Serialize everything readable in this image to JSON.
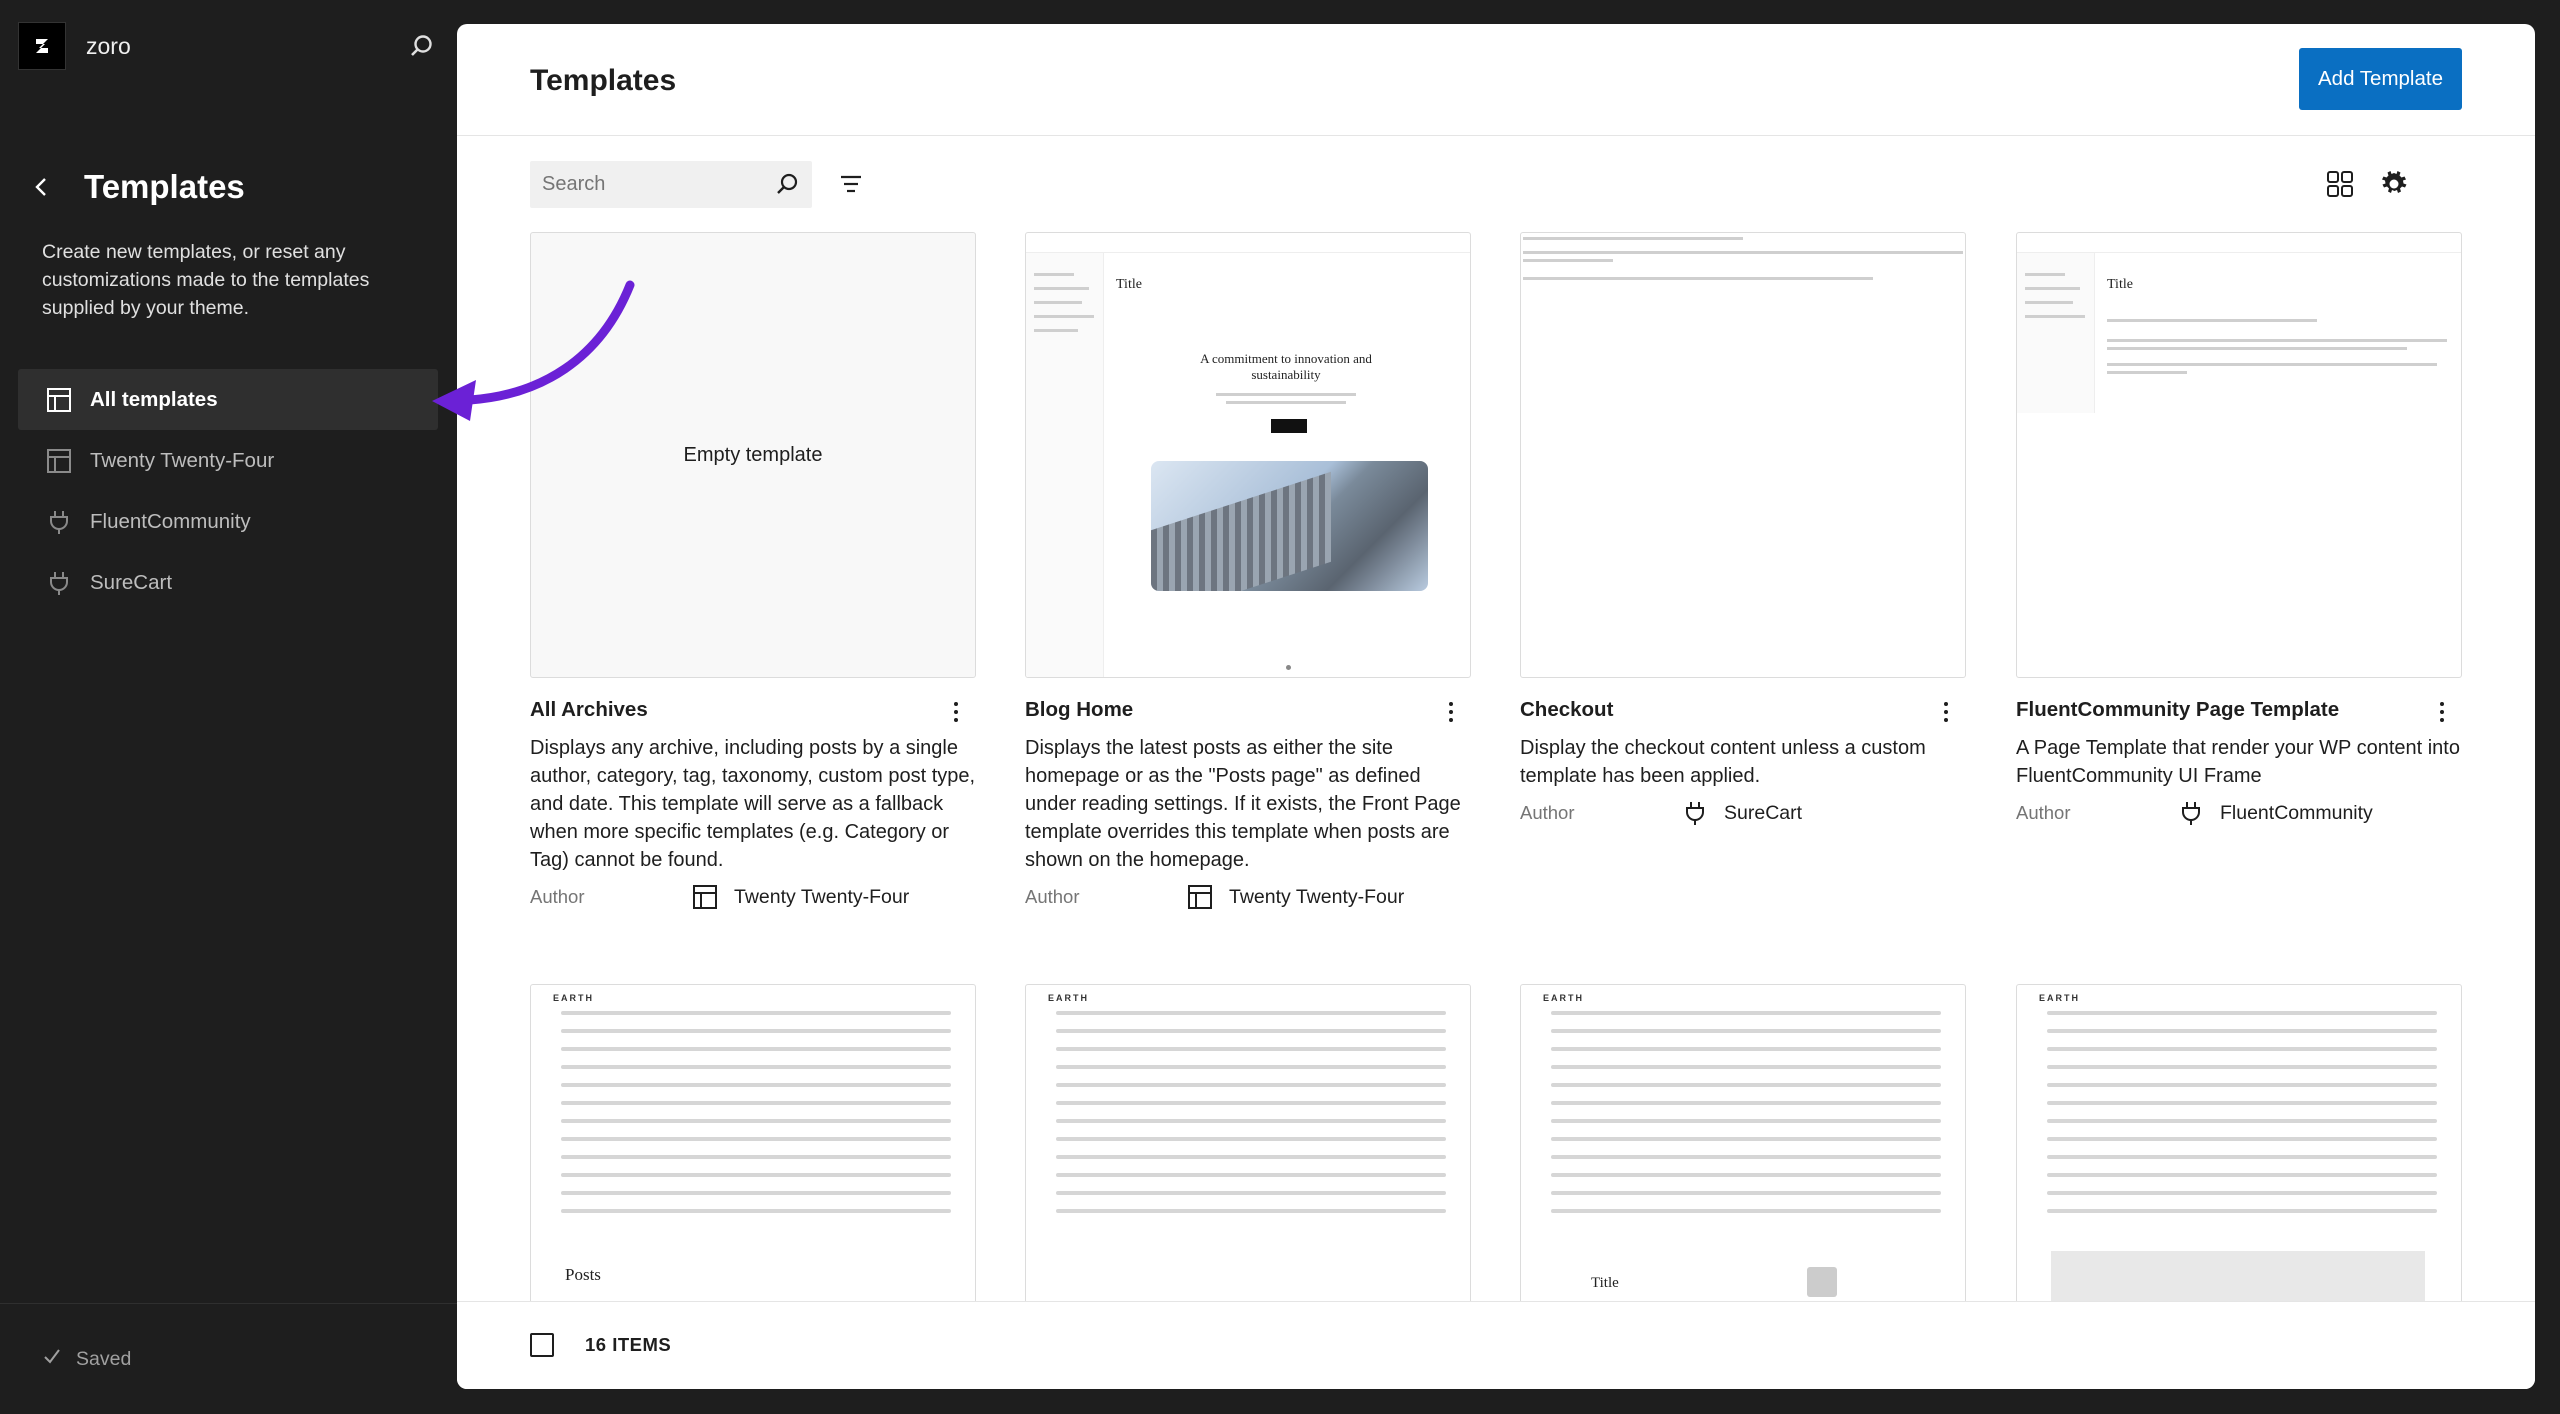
{
  "site": {
    "name": "zoro"
  },
  "sidebar": {
    "title": "Templates",
    "description": "Create new templates, or reset any customizations made to the templates supplied by your theme.",
    "items": [
      {
        "label": "All templates",
        "icon": "layout-icon",
        "active": true
      },
      {
        "label": "Twenty Twenty-Four",
        "icon": "layout-icon",
        "active": false
      },
      {
        "label": "FluentCommunity",
        "icon": "plugin-icon",
        "active": false
      },
      {
        "label": "SureCart",
        "icon": "plugin-icon",
        "active": false
      }
    ],
    "status": "Saved"
  },
  "header": {
    "title": "Templates",
    "add_button": "Add Template"
  },
  "search": {
    "placeholder": "Search"
  },
  "cards": [
    {
      "title": "All Archives",
      "thumb_label": "Empty template",
      "description": "Displays any archive, including posts by a single author, category, tag, taxonomy, custom post type, and date. This template will serve as a fallback when more specific templates (e.g. Category or Tag) cannot be found.",
      "author_label": "Author",
      "author": "Twenty Twenty-Four",
      "author_icon": "layout-icon"
    },
    {
      "title": "Blog Home",
      "thumb_title": "Title",
      "thumb_heading": "A commitment to innovation and sustainability",
      "description": "Displays the latest posts as either the site homepage or as the \"Posts page\" as defined under reading settings. If it exists, the Front Page template overrides this template when posts are shown on the homepage.",
      "author_label": "Author",
      "author": "Twenty Twenty-Four",
      "author_icon": "layout-icon"
    },
    {
      "title": "Checkout",
      "description": "Display the checkout content unless a custom template has been applied.",
      "author_label": "Author",
      "author": "SureCart",
      "author_icon": "plugin-icon"
    },
    {
      "title": "FluentCommunity Page Template",
      "thumb_title": "Title",
      "description": "A Page Template that render your WP content into FluentCommunity UI Frame",
      "author_label": "Author",
      "author": "FluentCommunity",
      "author_icon": "plugin-icon"
    }
  ],
  "row2": [
    {
      "brand": "EARTH",
      "caption": "Posts"
    },
    {
      "brand": "EARTH",
      "caption": ""
    },
    {
      "brand": "EARTH",
      "caption": "Title"
    },
    {
      "brand": "EARTH",
      "caption": ""
    }
  ],
  "footer": {
    "count": "16 ITEMS"
  },
  "colors": {
    "accent": "#0a6fc2",
    "arrow": "#6b21d6",
    "sidebar_bg": "#1e1e1e"
  }
}
